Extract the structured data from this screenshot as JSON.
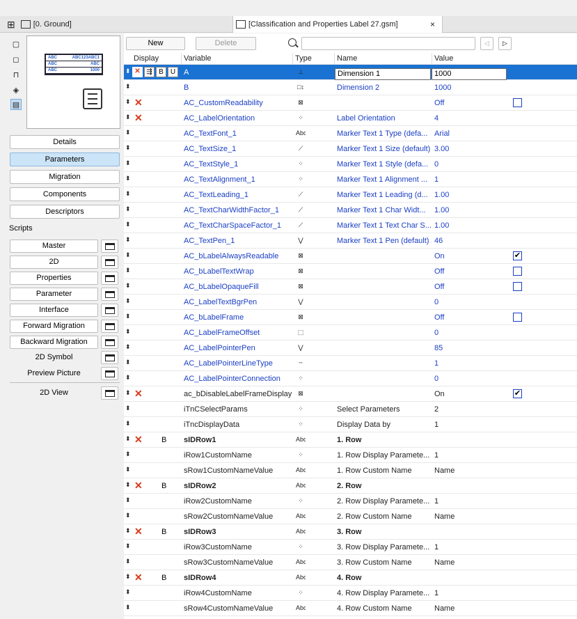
{
  "tabs": {
    "left_label": "[0. Ground]",
    "right_label": "[Classification and Properties Label 27.gsm]",
    "close_glyph": "×"
  },
  "preview_table": [
    [
      "ABC",
      "ABC123ABC1"
    ],
    [
      "ABC",
      "ABC"
    ],
    [
      "ABC",
      "1000"
    ]
  ],
  "left_buttons": [
    "Details",
    "Parameters",
    "Migration",
    "Components",
    "Descriptors"
  ],
  "scripts_label": "Scripts",
  "script_buttons": [
    "Master",
    "2D",
    "Properties",
    "Parameter",
    "Interface",
    "Forward Migration",
    "Backward Migration"
  ],
  "plain_items": [
    "2D Symbol",
    "Preview Picture"
  ],
  "view_2d": "2D View",
  "toolbar": {
    "new_label": "New",
    "delete_label": "Delete",
    "search_value": ""
  },
  "columns": {
    "display": "Display",
    "variable": "Variable",
    "type": "Type",
    "name": "Name",
    "value": "Value"
  },
  "rows": [
    {
      "var": "A",
      "type": "dim",
      "name": "Dimension 1",
      "val": "1000",
      "x": true,
      "sel": true
    },
    {
      "var": "B",
      "type": "dimb",
      "name": "Dimension 2",
      "val": "1000"
    },
    {
      "var": "AC_CustomReadability",
      "type": "bool",
      "name": "",
      "val": "Off",
      "x": true,
      "chk": "off"
    },
    {
      "var": "AC_LabelOrientation",
      "type": "int",
      "name": "Label Orientation",
      "val": "4",
      "x": true
    },
    {
      "var": "AC_TextFont_1",
      "type": "abc",
      "name": "Marker Text 1 Type (defa...",
      "val": "Arial"
    },
    {
      "var": "AC_TextSize_1",
      "type": "real",
      "name": "Marker Text 1 Size (default)",
      "val": "3.00"
    },
    {
      "var": "AC_TextStyle_1",
      "type": "int",
      "name": "Marker Text 1 Style (defa...",
      "val": "0"
    },
    {
      "var": "AC_TextAlignment_1",
      "type": "int",
      "name": "Marker Text 1 Alignment ...",
      "val": "1"
    },
    {
      "var": "AC_TextLeading_1",
      "type": "real",
      "name": "Marker Text 1 Leading (d...",
      "val": "1.00"
    },
    {
      "var": "AC_TextCharWidthFactor_1",
      "type": "real",
      "name": "Marker Text 1 Char Widt...",
      "val": "1.00"
    },
    {
      "var": "AC_TextCharSpaceFactor_1",
      "type": "real",
      "name": "Marker Text 1 Text Char S...",
      "val": "1.00"
    },
    {
      "var": "AC_TextPen_1",
      "type": "pen",
      "name": "Marker Text 1 Pen (default)",
      "val": "46"
    },
    {
      "var": "AC_bLabelAlwaysReadable",
      "type": "bool",
      "name": "",
      "val": "On",
      "chk": "on"
    },
    {
      "var": "AC_bLabelTextWrap",
      "type": "bool",
      "name": "",
      "val": "Off",
      "chk": "off"
    },
    {
      "var": "AC_bLabelOpaqueFill",
      "type": "bool",
      "name": "",
      "val": "Off",
      "chk": "off"
    },
    {
      "var": "AC_LabelTextBgrPen",
      "type": "pen",
      "name": "",
      "val": "0"
    },
    {
      "var": "AC_bLabelFrame",
      "type": "bool",
      "name": "",
      "val": "Off",
      "chk": "off"
    },
    {
      "var": "AC_LabelFrameOffset",
      "type": "frame",
      "name": "",
      "val": "0"
    },
    {
      "var": "AC_LabelPointerPen",
      "type": "pen",
      "name": "",
      "val": "85"
    },
    {
      "var": "AC_LabelPointerLineType",
      "type": "line",
      "name": "",
      "val": "1"
    },
    {
      "var": "AC_LabelPointerConnection",
      "type": "int",
      "name": "",
      "val": "0"
    },
    {
      "var": "ac_bDisableLabelFrameDisplay",
      "type": "bool",
      "name": "",
      "val": "On",
      "x": true,
      "chk": "on",
      "blk": true
    },
    {
      "var": "iTnCSelectParams",
      "type": "int",
      "name": "Select Parameters",
      "val": "2",
      "blk": true
    },
    {
      "var": "iTncDisplayData",
      "type": "int",
      "name": "Display Data by",
      "val": "1",
      "blk": true
    },
    {
      "var": "sIDRow1",
      "type": "abc",
      "name": "1. Row",
      "val": "",
      "x": true,
      "b": "B",
      "blk": true,
      "bold": true
    },
    {
      "var": "iRow1CustomName",
      "type": "int",
      "name": "1. Row Display Paramete...",
      "val": "1",
      "blk": true
    },
    {
      "var": "sRow1CustomNameValue",
      "type": "abc",
      "name": "1. Row Custom Name",
      "val": "Name",
      "blk": true
    },
    {
      "var": "sIDRow2",
      "type": "abc",
      "name": "2. Row",
      "val": "",
      "x": true,
      "b": "B",
      "blk": true,
      "bold": true
    },
    {
      "var": "iRow2CustomName",
      "type": "int",
      "name": "2. Row Display Paramete...",
      "val": "1",
      "blk": true
    },
    {
      "var": "sRow2CustomNameValue",
      "type": "abc",
      "name": "2. Row Custom Name",
      "val": "Name",
      "blk": true
    },
    {
      "var": "sIDRow3",
      "type": "abc",
      "name": "3. Row",
      "val": "",
      "x": true,
      "b": "B",
      "blk": true,
      "bold": true
    },
    {
      "var": "iRow3CustomName",
      "type": "int",
      "name": "3. Row Display Paramete...",
      "val": "1",
      "blk": true
    },
    {
      "var": "sRow3CustomNameValue",
      "type": "abc",
      "name": "3. Row Custom Name",
      "val": "Name",
      "blk": true
    },
    {
      "var": "sIDRow4",
      "type": "abc",
      "name": "4. Row",
      "val": "",
      "x": true,
      "b": "B",
      "blk": true,
      "bold": true
    },
    {
      "var": "iRow4CustomName",
      "type": "int",
      "name": "4. Row Display Paramete...",
      "val": "1",
      "blk": true
    },
    {
      "var": "sRow4CustomNameValue",
      "type": "abc",
      "name": "4. Row Custom Name",
      "val": "Name",
      "blk": true
    }
  ],
  "type_glyphs": {
    "dim": "⊥",
    "dimb": "□↕",
    "bool": "⊠",
    "int": "⁘",
    "abc": "Abc",
    "real": "⟋",
    "pen": "⋁",
    "frame": "⬚",
    "line": "╌"
  },
  "selected_row_buttons": [
    "B",
    "U"
  ],
  "colors": {
    "accent": "#1a72d2",
    "variable_blue": "#1a3fc4",
    "delete_red": "#d83b1a"
  }
}
